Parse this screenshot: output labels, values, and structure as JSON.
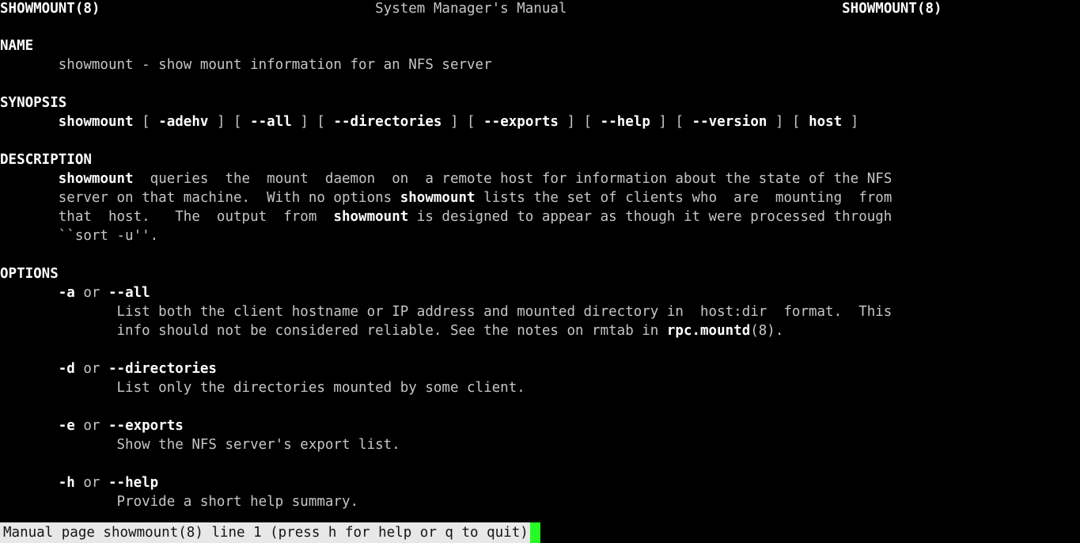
{
  "terminal": {
    "program": "man",
    "pager": "less",
    "background_color": "#000000",
    "foreground_color": "#c6c6c6",
    "bold_color": "#ffffff",
    "cursor_color": "#24fc24",
    "status_bg_color": "#e8e8e8",
    "status_fg_color": "#141414",
    "columns": 120,
    "rows": 28
  },
  "manpage": {
    "header": {
      "left": "SHOWMOUNT(8)",
      "center": "System Manager's Manual",
      "right": "SHOWMOUNT(8)"
    },
    "sections": [
      {
        "heading": "NAME",
        "body": [
          "showmount - show mount information for an NFS server"
        ]
      },
      {
        "heading": "SYNOPSIS",
        "body": [
          "showmount [ -adehv ] [ --all ] [ --directories ] [ --exports ] [ --help ] [ --version ] [ host ]"
        ]
      },
      {
        "heading": "DESCRIPTION",
        "body": [
          "showmount  queries  the  mount  daemon  on  a remote host for information about the state of the NFS",
          "server on that machine.  With no options showmount lists the set of clients who  are  mounting  from",
          "that  host.   The  output  from  showmount is designed to appear as though it were processed through",
          "``sort -u''."
        ]
      },
      {
        "heading": "OPTIONS",
        "options": [
          {
            "short": "-a",
            "conjunction": "or",
            "long": "--all",
            "description": [
              "List both the client hostname or IP address and mounted directory in  host:dir  format.  This",
              "info should not be considered reliable. See the notes on rmtab in rpc.mountd(8)."
            ]
          },
          {
            "short": "-d",
            "conjunction": "or",
            "long": "--directories",
            "description": [
              "List only the directories mounted by some client."
            ]
          },
          {
            "short": "-e",
            "conjunction": "or",
            "long": "--exports",
            "description": [
              "Show the NFS server's export list."
            ]
          },
          {
            "short": "-h",
            "conjunction": "or",
            "long": "--help",
            "description": [
              "Provide a short help summary."
            ]
          }
        ]
      }
    ]
  },
  "status_bar": {
    "text": "Manual page showmount(8) line 1 (press h for help or q to quit)",
    "page_name": "showmount(8)",
    "line_number": "1",
    "help_key": "h",
    "quit_key": "q"
  },
  "lines": {
    "l01_left": "SHOWMOUNT(8)",
    "l01_gap1": "                                 ",
    "l01_center": "System Manager's Manual",
    "l01_gap2": "                                 ",
    "l01_right": "SHOWMOUNT(8)",
    "l02": "",
    "l03": "NAME",
    "l04": "       showmount - show mount information for an NFS server",
    "l05": "",
    "l06": "SYNOPSIS",
    "l07_indent": "       ",
    "l07_a": "showmount",
    "l07_b": " [ ",
    "l07_c": "-adehv",
    "l07_d": " ] [ ",
    "l07_e": "--all",
    "l07_f": " ] [ ",
    "l07_g": "--directories",
    "l07_h": " ] [ ",
    "l07_i": "--exports",
    "l07_j": " ] [ ",
    "l07_k": "--help",
    "l07_l": " ] [ ",
    "l07_m": "--version",
    "l07_n": " ] [ ",
    "l07_o": "host",
    "l07_p": " ]",
    "l08": "",
    "l09": "DESCRIPTION",
    "l10_indent": "       ",
    "l10_a": "showmount",
    "l10_b": "  queries  the  mount  daemon  on  a remote host for information about the state of the NFS",
    "l11_a": "       server on that machine.  With no options ",
    "l11_b": "showmount",
    "l11_c": " lists the set of clients who  are  mounting  from",
    "l12_a": "       that  host.   The  output  from  ",
    "l12_b": "showmount",
    "l12_c": " is designed to appear as though it were processed through",
    "l13": "       ``sort -u''.",
    "l14": "",
    "l15": "OPTIONS",
    "l16_indent": "       ",
    "l16_a": "-a",
    "l16_b": " or ",
    "l16_c": "--all",
    "l17": "              List both the client hostname or IP address and mounted directory in  host:dir  format.  This",
    "l18_a": "              info should not be considered reliable. See the notes on rmtab in ",
    "l18_b": "rpc.mountd",
    "l18_c": "(8).",
    "l19": "",
    "l20_indent": "       ",
    "l20_a": "-d",
    "l20_b": " or ",
    "l20_c": "--directories",
    "l21": "              List only the directories mounted by some client.",
    "l22": "",
    "l23_indent": "       ",
    "l23_a": "-e",
    "l23_b": " or ",
    "l23_c": "--exports",
    "l24": "              Show the NFS server's export list.",
    "l25": "",
    "l26_indent": "       ",
    "l26_a": "-h",
    "l26_b": " or ",
    "l26_c": "--help",
    "l27": "              Provide a short help summary."
  }
}
